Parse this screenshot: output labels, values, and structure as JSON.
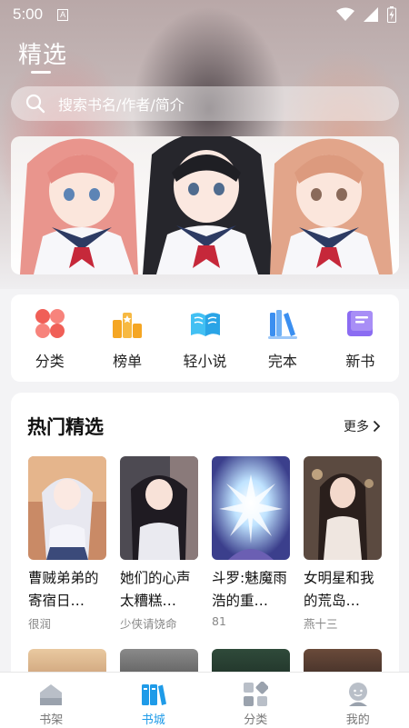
{
  "status_bar": {
    "time": "5:00",
    "notification_letter": "A"
  },
  "header": {
    "title": "精选"
  },
  "search": {
    "placeholder": "搜索书名/作者/简介"
  },
  "quick_categories": [
    {
      "label": "分类",
      "icon": "category-icon",
      "color": "#f0504a"
    },
    {
      "label": "榜单",
      "icon": "ranking-icon",
      "color": "#f5a623"
    },
    {
      "label": "轻小说",
      "icon": "light-novel-icon",
      "color": "#2cb4f0"
    },
    {
      "label": "完本",
      "icon": "finished-books-icon",
      "color": "#3b8ff0"
    },
    {
      "label": "新书",
      "icon": "new-book-icon",
      "color": "#8b6cf2"
    }
  ],
  "hot_picks": {
    "title": "热门精选",
    "more_label": "更多",
    "books": [
      {
        "title": "曹贼弟弟的寄宿日…",
        "author": "很润"
      },
      {
        "title": "她们的心声太糟糕…",
        "author": "少侠请饶命"
      },
      {
        "title": "斗罗:魅魔雨浩的重…",
        "author": "81"
      },
      {
        "title": "女明星和我的荒岛…",
        "author": "燕十三"
      }
    ]
  },
  "bottom_nav": [
    {
      "label": "书架",
      "icon": "bookshelf-icon",
      "active": false
    },
    {
      "label": "书城",
      "icon": "bookstore-icon",
      "active": true
    },
    {
      "label": "分类",
      "icon": "category-grid-icon",
      "active": false
    },
    {
      "label": "我的",
      "icon": "profile-icon",
      "active": false
    }
  ],
  "colors": {
    "accent": "#1f9be8"
  }
}
